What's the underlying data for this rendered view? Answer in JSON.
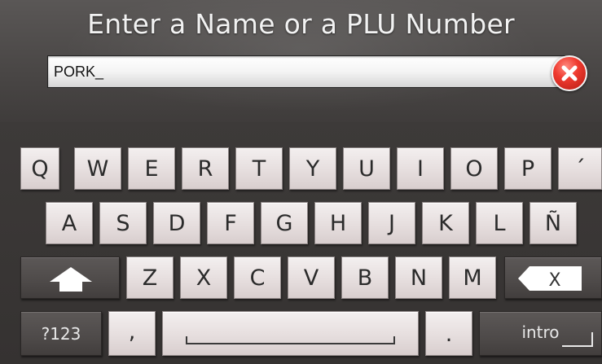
{
  "title": "Enter a Name or a PLU Number",
  "search": {
    "value": "PORK_"
  },
  "clear_button": {
    "icon": "close-icon",
    "color": "#e8372c"
  },
  "keyboard": {
    "row1": [
      "Q",
      "W",
      "E",
      "R",
      "T",
      "Y",
      "U",
      "I",
      "O",
      "P",
      "´"
    ],
    "row2": [
      "A",
      "S",
      "D",
      "F",
      "G",
      "H",
      "J",
      "K",
      "L",
      "Ñ"
    ],
    "row3": [
      "Z",
      "X",
      "C",
      "V",
      "B",
      "N",
      "M"
    ],
    "shift_icon": "shift-arrow-icon",
    "backspace_icon": "backspace-icon",
    "backspace_label": "X",
    "numbers_label": "?123",
    "comma_label": ",",
    "space_icon": "space-bar-icon",
    "period_label": ".",
    "enter_label": "intro"
  }
}
